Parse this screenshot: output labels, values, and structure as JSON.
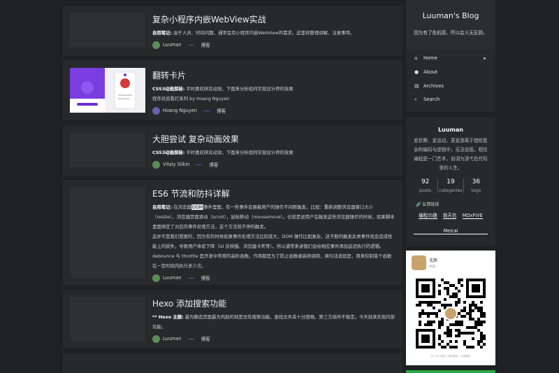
{
  "posts": [
    {
      "title": "复杂小程序内嵌WebView实战",
      "excerpt_label": "自用笔记:",
      "excerpt": "由于人员、时间问题，通常会有小程序内嵌WebView的需求。这里将整理讲解、注意事项。",
      "author": "Luuman",
      "category": "博客"
    },
    {
      "title": "翻转卡片",
      "excerpt_label": "CSS3动画探秘:",
      "excerpt": "平时喜欢研究动效，下面来分析如何实现设计师的效果",
      "extra": "程序员追看打系列 by Hoang Nguyen",
      "author": "Hoang Nguyen",
      "category": "博客"
    },
    {
      "title": "大胆尝试 复杂动画效果",
      "excerpt_label": "CSS3动画探秘:",
      "excerpt": "平时喜欢研究动效，下面来分析如何实现设计师的效果",
      "author": "Vitaly Silkin",
      "category": "博客"
    },
    {
      "title": "ES6 节流和防抖详解",
      "excerpt_label": "自用笔记:",
      "excerpt_pre": "在浏览器",
      "excerpt_hl": "DOM",
      "excerpt_post": "事件里面，有一些事件会随着用户的操作不间断触发。比如：重新调整浏览器窗口大小（resize），浏览器页面滚动（scroll），鼠标移动（mousemove）。也就是说用户在触发这些浏览器操作的时候，如果脚本里面绑定了对应的事件处理方法，这个方法就不停的触发。",
      "excerpt2": "这并不是我们想要的，因为有的时候如果事件处理方法比较庞大，DOM 操作比如复杂，还不断的触发此类事件就会造成性能上的损失，导致用户体验下降（UI 反映慢、浏览器卡死等）。所以通常来讲我们会给相应事件添加延迟执行的逻辑。",
      "excerpt3": "debounce 与 throttle 是开发中常用的高阶函数。作用都是为了防止函数被高频调用，换句话说就是，用来控制某个函数在一定时间内执行多少次。",
      "author": "Luuman",
      "category": "博客"
    },
    {
      "title": "Hexo 添加搜索功能",
      "excerpt_label": "** Hexo 主题:",
      "excerpt": "最为静态页面最为鸡肋的就是没有搜索功能。查找文件夹十分困难。第三方插件不稳定。今天就来实现内部功能。",
      "author": "Luuman",
      "category": "博客"
    }
  ],
  "sidebar": {
    "blog_title": "Luuman's Blog",
    "blog_subtitle": "因为有了危机感，所以会义无反顾。",
    "nav": [
      {
        "label": "Home",
        "icon": "home-icon"
      },
      {
        "label": "About",
        "icon": "user-icon"
      },
      {
        "label": "Archives",
        "icon": "archive-icon"
      },
      {
        "label": "Search",
        "icon": "search-icon"
      }
    ],
    "author": "Luuman",
    "bio": "爱折腾、爱运动，更爱游离于错综复杂的编码与逻辑中，无法自拔。相信编程是一门艺术，自诩为游弋在代码里的人生。",
    "stats": [
      {
        "count": "92",
        "label": "posts"
      },
      {
        "count": "19",
        "label": "categories"
      },
      {
        "count": "36",
        "label": "tags"
      }
    ],
    "links_heading": "友情链接",
    "links": [
      "编程の趣",
      "翁天信",
      "MOxFIVE",
      "Meicai"
    ],
    "qr_name": "北辰",
    "qr_location": "中国",
    "qr_hint": "扫一扫上面的二维码图案，加我微信"
  },
  "colors": {
    "background": "#1f2123",
    "card": "#27292b",
    "accent": "#3d6ab8"
  }
}
